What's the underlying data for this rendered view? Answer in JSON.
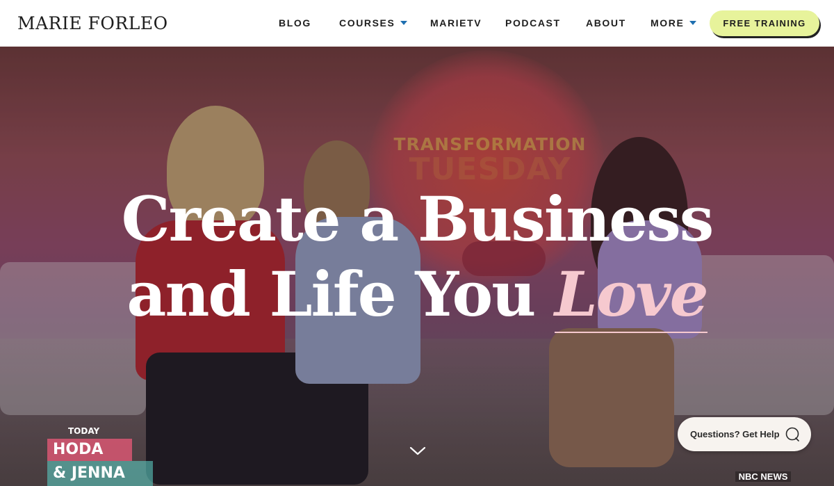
{
  "brand": {
    "logo_text": "MARIE FORLEO"
  },
  "nav": {
    "items": [
      {
        "label": "BLOG",
        "has_dropdown": false
      },
      {
        "label": "COURSES",
        "has_dropdown": true
      },
      {
        "label": "MARIETV",
        "has_dropdown": false
      },
      {
        "label": "PODCAST",
        "has_dropdown": false
      },
      {
        "label": "ABOUT",
        "has_dropdown": false
      },
      {
        "label": "MORE",
        "has_dropdown": true
      }
    ],
    "cta_label": "FREE TRAINING"
  },
  "hero": {
    "background_sign": {
      "line1": "TRANSFORMATION",
      "line2": "TUESDAY"
    },
    "headline_line1": "Create a Business",
    "headline_line2_main": "and Life You",
    "headline_accent": "Love",
    "scroll_icon": "chevron-down-icon",
    "show_badge": {
      "top": "TODAY",
      "middle": "HODA",
      "bottom": "& JENNA"
    },
    "network_badge": "NBC NEWS"
  },
  "help_widget": {
    "label": "Questions? Get Help",
    "icon": "chat-bubble-icon"
  },
  "colors": {
    "cta_background": "#e7f39b",
    "accent_pink": "#f6c9cf",
    "dropdown_caret": "#1e6fb0",
    "text_dark": "#1e1e1e"
  }
}
